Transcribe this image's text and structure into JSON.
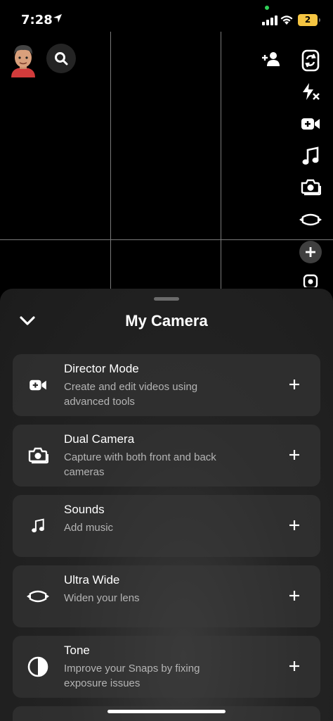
{
  "status_bar": {
    "time": "7:28",
    "battery": "2"
  },
  "sheet": {
    "title": "My Camera",
    "items": [
      {
        "title": "Director Mode",
        "subtitle": "Create and edit videos using advanced tools",
        "icon": "video-plus-icon"
      },
      {
        "title": "Dual Camera",
        "subtitle": "Capture with both front and back cameras",
        "icon": "dual-camera-icon"
      },
      {
        "title": "Sounds",
        "subtitle": "Add music",
        "icon": "music-note-icon"
      },
      {
        "title": "Ultra Wide",
        "subtitle": "Widen your lens",
        "icon": "ultra-wide-icon"
      },
      {
        "title": "Tone",
        "subtitle": "Improve your Snaps by fixing exposure issues",
        "icon": "tone-icon"
      }
    ]
  },
  "colors": {
    "background": "#000000",
    "sheet": "#232323",
    "card": "#333333",
    "subtitle": "#b4b4b4",
    "battery": "#f5c542"
  }
}
